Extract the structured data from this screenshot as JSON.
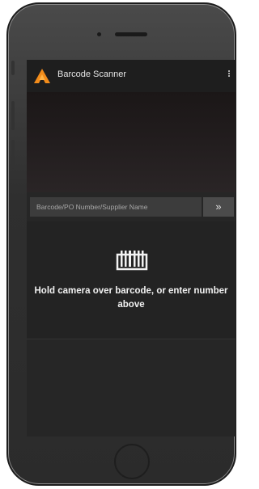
{
  "app": {
    "title": "Barcode Scanner",
    "logo_icon": "app-logo-icon",
    "menu_icon": "more-vert-icon"
  },
  "search": {
    "placeholder": "Barcode/PO Number/Supplier Name",
    "value": "",
    "submit_label": "»"
  },
  "prompt": {
    "icon": "barcode-icon",
    "text": "Hold camera over barcode, or enter number above"
  },
  "colors": {
    "accent": "#f28c1b",
    "background": "#262626",
    "appbar": "#1e1e1e"
  }
}
